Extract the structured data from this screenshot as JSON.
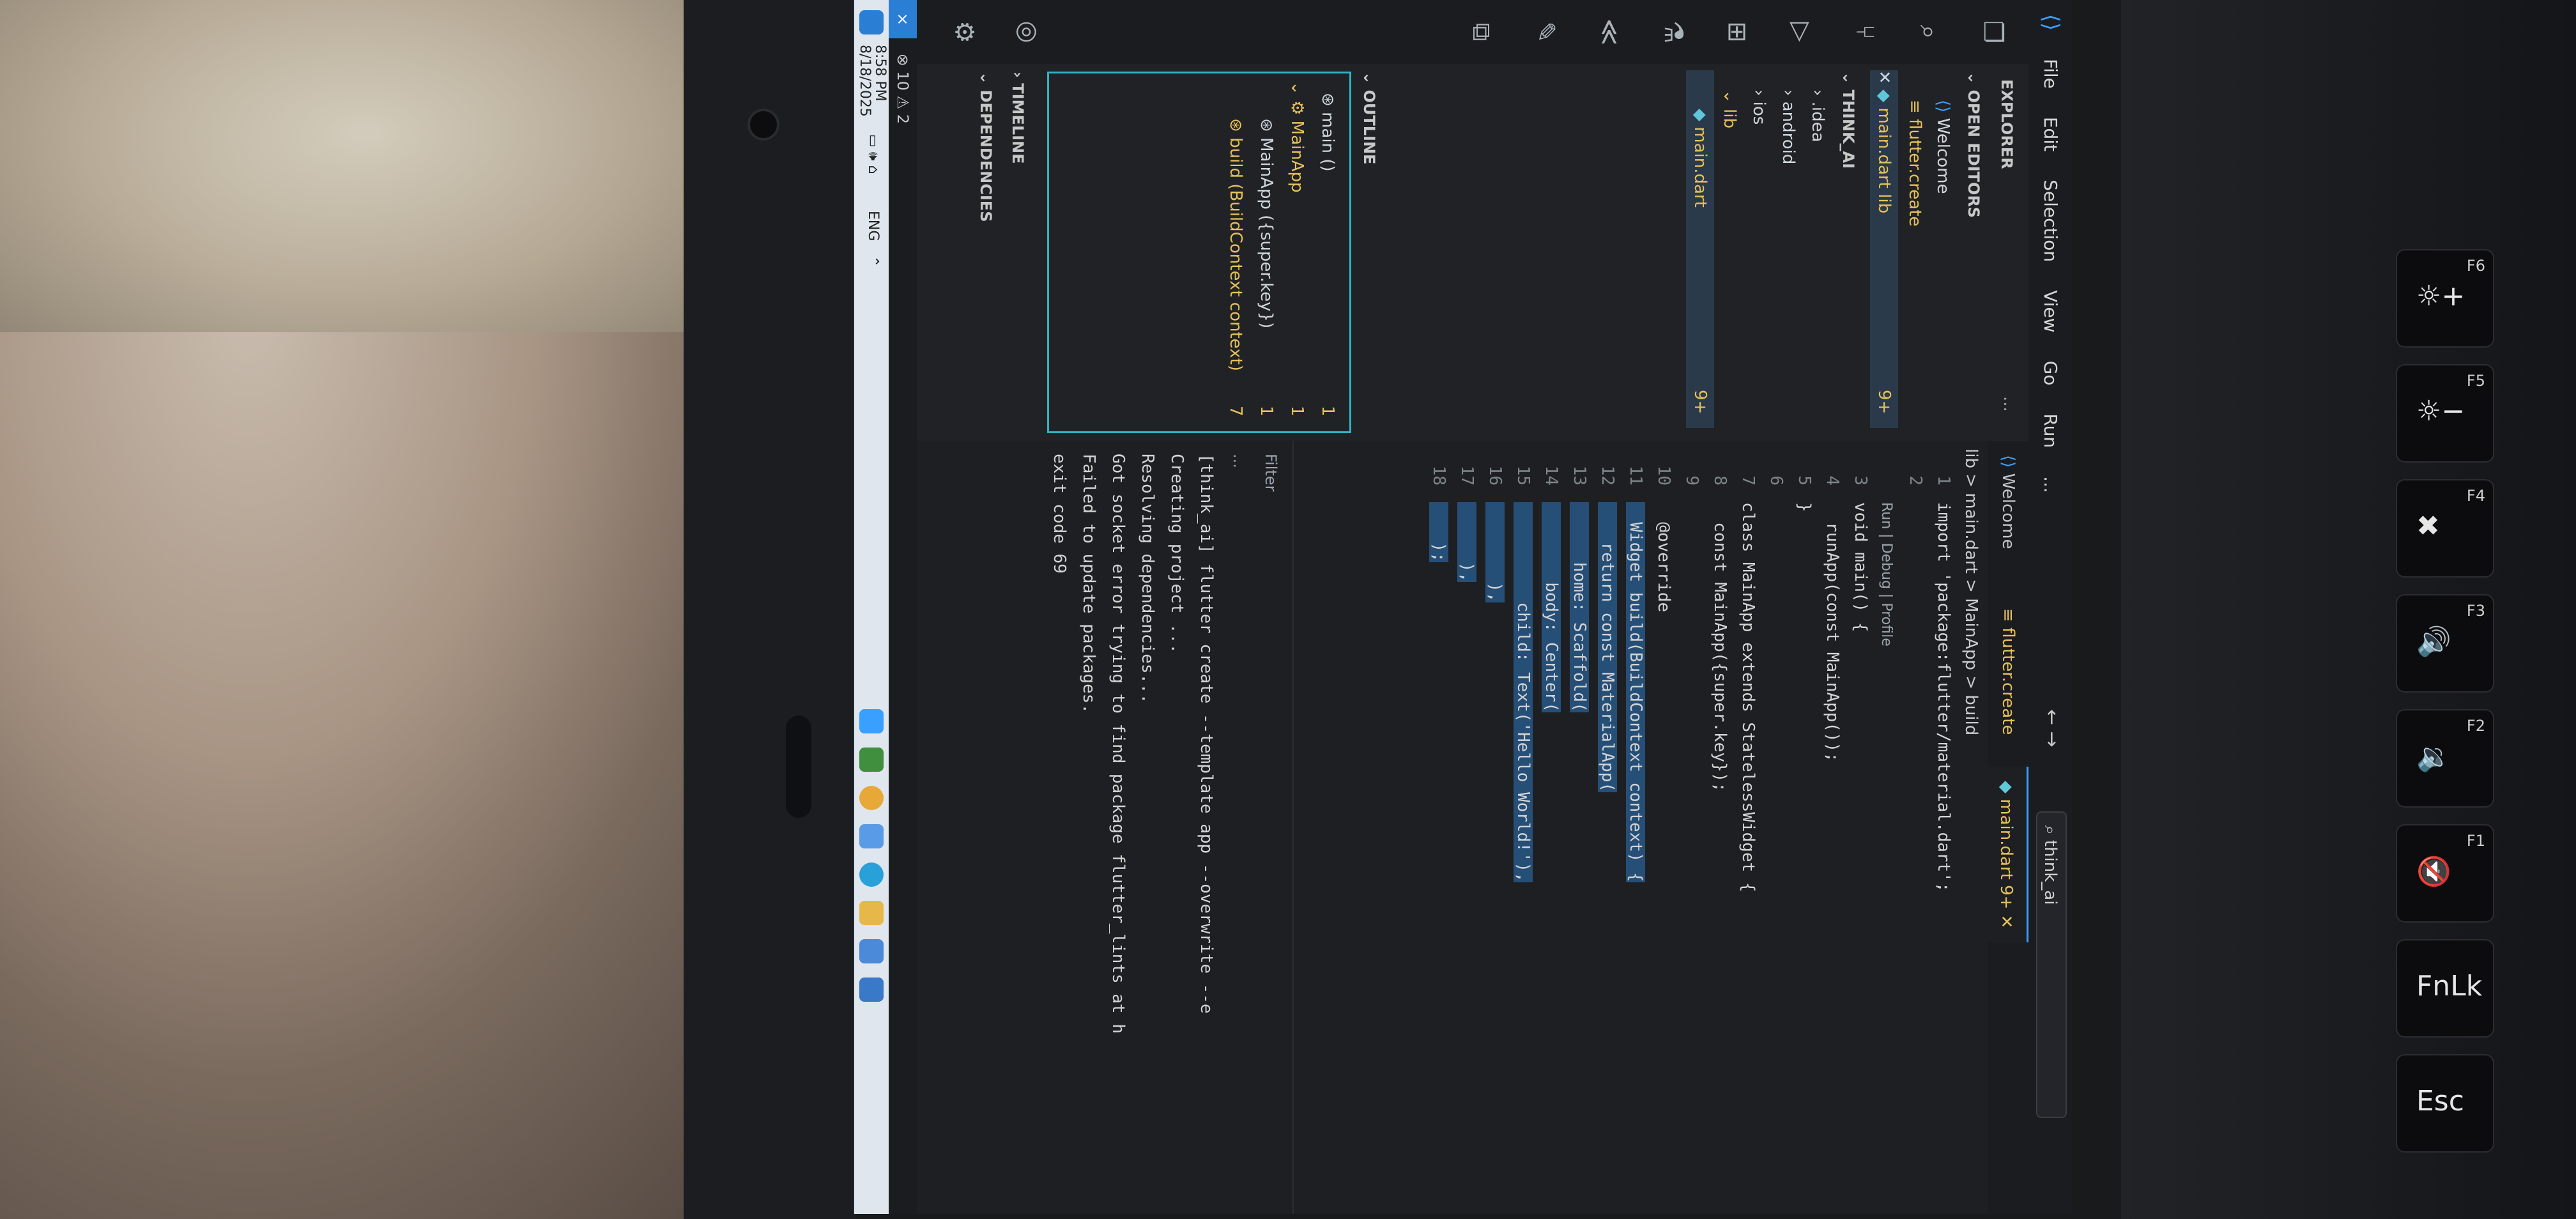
{
  "app": {
    "menu": [
      "File",
      "Edit",
      "Selection",
      "View",
      "Go",
      "Run",
      "..."
    ],
    "search": "think_ai",
    "nav_arrows": "← →"
  },
  "sidebar": {
    "title": "EXPLORER",
    "more": "...",
    "open_editors": "OPEN EDITORS",
    "open_items": [
      "Welcome",
      "flutter.create"
    ],
    "open_file": "main.dart lib",
    "open_file_badge": "9+",
    "project": "THINK_AI",
    "tree": [
      ".idea",
      "android",
      "ios",
      "lib",
      "main.dart"
    ],
    "tree_badge": "9+",
    "outline_title": "OUTLINE",
    "outline": [
      {
        "label": "main ()",
        "count": "1"
      },
      {
        "label": "MainApp",
        "count": "1"
      },
      {
        "label": "MainApp ({super.key})",
        "count": "1"
      },
      {
        "label": "build (BuildContext context)",
        "count": "7"
      }
    ],
    "timeline": "TIMELINE",
    "dependencies": "DEPENDENCIES"
  },
  "editor": {
    "tabs": [
      "Welcome",
      "flutter.create",
      "main.dart 9+"
    ],
    "breadcrumb": "lib > main.dart > MainApp > build",
    "lens": "Run | Debug | Profile",
    "lines": [
      {
        "n": "1",
        "t": "import 'package:flutter/material.dart';"
      },
      {
        "n": "2",
        "t": ""
      },
      {
        "n": "3",
        "t": "void main() {"
      },
      {
        "n": "4",
        "t": "  runApp(const MainApp());"
      },
      {
        "n": "5",
        "t": "}"
      },
      {
        "n": "6",
        "t": ""
      },
      {
        "n": "7",
        "t": "class MainApp extends StatelessWidget {"
      },
      {
        "n": "8",
        "t": "  const MainApp({super.key});"
      },
      {
        "n": "9",
        "t": ""
      },
      {
        "n": "10",
        "t": "  @override"
      },
      {
        "n": "11",
        "t": "  Widget build(BuildContext context) {"
      },
      {
        "n": "12",
        "t": "    return const MaterialApp("
      },
      {
        "n": "13",
        "t": "      home: Scaffold("
      },
      {
        "n": "14",
        "t": "        body: Center("
      },
      {
        "n": "15",
        "t": "          child: Text('Hello World!'),"
      },
      {
        "n": "16",
        "t": "        ),"
      },
      {
        "n": "17",
        "t": "      ),"
      },
      {
        "n": "18",
        "t": "    );"
      }
    ]
  },
  "panel": {
    "filter": "Filter",
    "ellipsis": "...",
    "terminal": [
      "[think_ai] flutter create --template app --overwrite --e",
      "Creating project ...",
      "Resolving dependencies...",
      "Got socket error trying to find package flutter_lints at h",
      "Failed to update packages.",
      "exit code 69"
    ]
  },
  "status": {
    "errors": "10",
    "warnings": "2"
  },
  "taskbar": {
    "time": "8:58 PM",
    "date": "8/18/2025",
    "lang": "ENG"
  },
  "keyboard": {
    "keys": [
      {
        "main": "Esc",
        "sub": ""
      },
      {
        "main": "FnLk",
        "sub": ""
      },
      {
        "main": "🔇",
        "sub": "F1"
      },
      {
        "main": "🔉",
        "sub": "F2"
      },
      {
        "main": "🔊",
        "sub": "F3"
      },
      {
        "main": "✖",
        "sub": "F4"
      },
      {
        "main": "☼−",
        "sub": "F5"
      },
      {
        "main": "☼+",
        "sub": "F6"
      }
    ]
  },
  "colors": {
    "accent": "#3aa0ff",
    "outline_border": "#2fb3c5",
    "warning_text": "#e6c15a"
  }
}
